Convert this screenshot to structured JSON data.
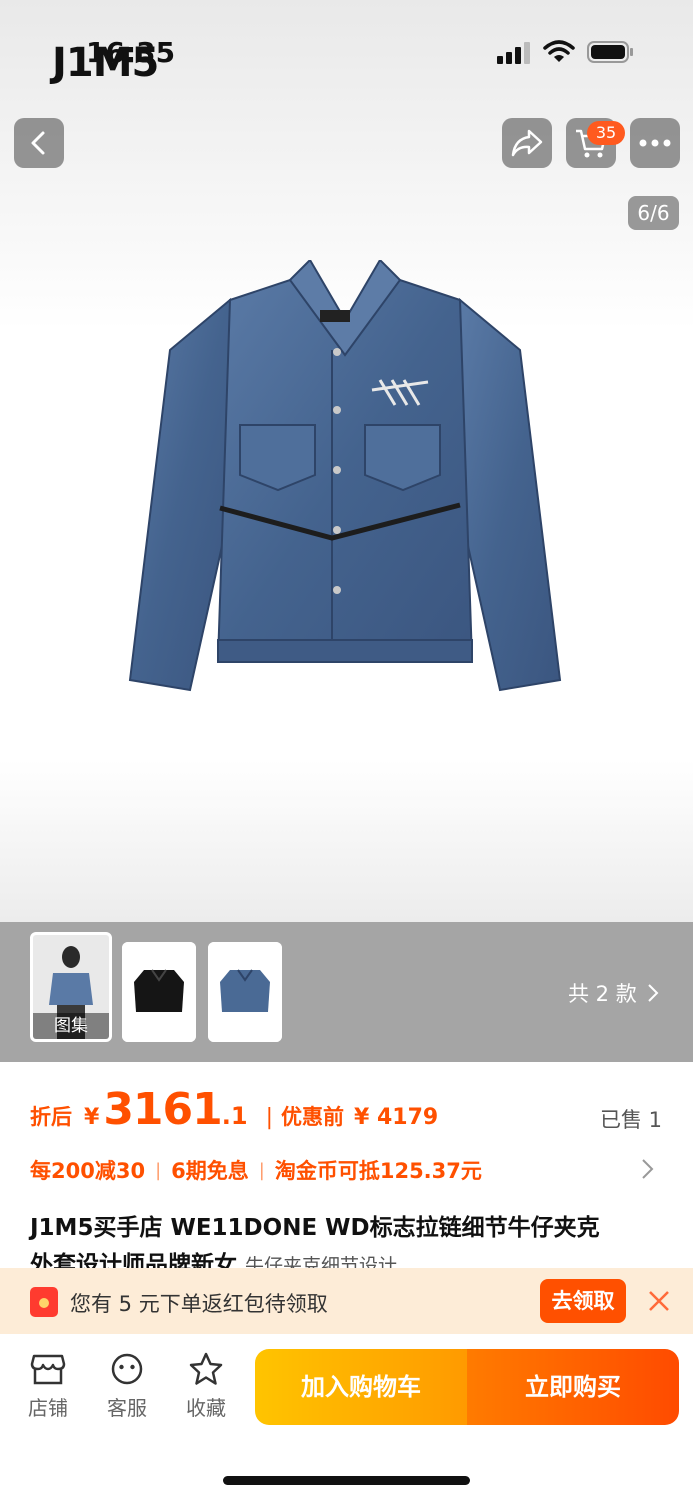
{
  "status_bar": {
    "time": "16:35",
    "watermark": "J1M5"
  },
  "header": {
    "back_icon": "chevron-left-icon",
    "share_icon": "share-icon",
    "cart_icon": "cart-icon",
    "more_icon": "more-dots-icon",
    "cart_badge": "35",
    "page_indicator": "6/6"
  },
  "gallery": {
    "thumbnails": [
      {
        "label": "图集"
      },
      {
        "label": ""
      },
      {
        "label": ""
      }
    ],
    "variants_label": "共 2 款"
  },
  "price": {
    "after_label": "折后",
    "currency": "¥",
    "integer": "3161",
    "decimal": ".1",
    "separator": "|",
    "before_label": "优惠前",
    "original": "¥ 4179",
    "sold": "已售 1"
  },
  "promos": [
    "每200减30",
    "6期免息",
    "淘金币可抵125.37元"
  ],
  "product": {
    "title_line1": "J1M5买手店 WE11DONE WD标志拉链细节牛仔夹克",
    "title_line2": "外套设计师品牌新女",
    "subtitle": "牛仔夹克细节设计"
  },
  "coupon": {
    "text": "您有 5 元下单返红包待领取",
    "button": "去领取"
  },
  "bottom_bar": {
    "store": "店铺",
    "service": "客服",
    "favorite": "收藏",
    "add_to_cart": "加入购物车",
    "buy_now": "立即购买"
  },
  "colors": {
    "accent": "#ff5000",
    "cart_gradient_start": "#ffc400",
    "buy_gradient_end": "#ff4b00",
    "denim": "#4a6a95"
  }
}
